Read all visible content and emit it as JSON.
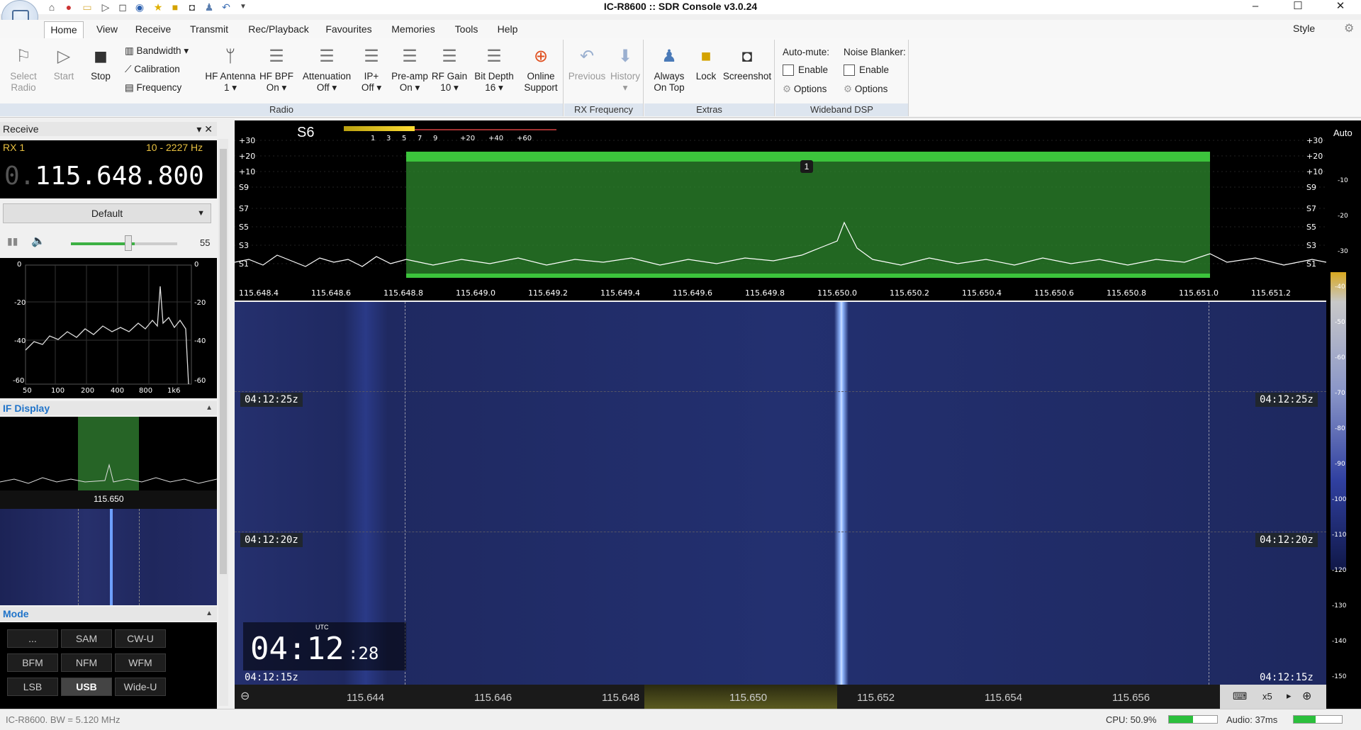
{
  "title": "IC-R8600 :: SDR Console v3.0.24",
  "tabs": [
    "Home",
    "View",
    "Receive",
    "Transmit",
    "Rec/Playback",
    "Favourites",
    "Memories",
    "Tools",
    "Help"
  ],
  "style_label": "Style",
  "ribbon": {
    "select_radio": "Select\nRadio",
    "start": "Start",
    "stop": "Stop",
    "bandwidth": "Bandwidth",
    "calibration": "Calibration",
    "frequency": "Frequency",
    "hf_antenna": "HF Antenna",
    "hf_antenna_val": "1",
    "hf_bpf": "HF BPF",
    "hf_bpf_val": "On",
    "attenuation": "Attenuation",
    "attenuation_val": "Off",
    "ip_plus": "IP+",
    "ip_plus_val": "Off",
    "preamp": "Pre-amp",
    "preamp_val": "On",
    "rf_gain": "RF Gain",
    "rf_gain_val": "10",
    "bit_depth": "Bit Depth",
    "bit_depth_val": "16",
    "online_support": "Online\nSupport",
    "previous": "Previous",
    "history": "History",
    "always_on_top": "Always\nOn Top",
    "lock": "Lock",
    "screenshot": "Screenshot",
    "auto_mute": "Auto-mute:",
    "noise_blanker": "Noise Blanker:",
    "enable": "Enable",
    "options": "Options",
    "groups": {
      "radio": "Radio",
      "rx_frequency": "RX Frequency",
      "extras": "Extras",
      "wideband_dsp": "Wideband DSP"
    }
  },
  "left": {
    "receive_title": "Receive",
    "rx": "RX 1",
    "bw": "10 - 2227 Hz",
    "freq_prefix": "0.",
    "freq": "115.648.800",
    "preset": "Default",
    "volume": "55",
    "audio_scale_y": [
      "0",
      "-20",
      "-40",
      "-60"
    ],
    "audio_scale_x": [
      "50",
      "100",
      "200",
      "400",
      "800",
      "1k6"
    ],
    "if_display_title": "IF Display",
    "if_freq": "115.650",
    "mode_title": "Mode",
    "modes": [
      "...",
      "SAM",
      "CW-U",
      "BFM",
      "NFM",
      "WFM",
      "LSB",
      "USB",
      "Wide-U"
    ]
  },
  "spectrum": {
    "s_meter": "S6",
    "auto": "Auto",
    "meter_scale": [
      "1",
      "3",
      "5",
      "7",
      "9",
      "+20",
      "+40",
      "+60"
    ],
    "db_left": [
      "+30",
      "+20",
      "+10",
      "S9",
      "S7",
      "S5",
      "S3",
      "S1"
    ],
    "db_right": [
      "+30",
      "+20",
      "+10",
      "S9",
      "S7",
      "S5",
      "S3",
      "S1"
    ],
    "marker": "1",
    "freq_ticks": [
      "115.648.4",
      "115.648.6",
      "115.648.8",
      "115.649.0",
      "115.649.2",
      "115.649.4",
      "115.649.6",
      "115.649.8",
      "115.650.0",
      "115.650.2",
      "115.650.4",
      "115.650.6",
      "115.650.8",
      "115.651.0",
      "115.651.2"
    ],
    "right_scale": [
      "-10",
      "-20",
      "-30",
      "-40",
      "-50",
      "-60",
      "-70",
      "-80",
      "-90",
      "-100",
      "-110",
      "-120",
      "-130",
      "-140",
      "-150"
    ]
  },
  "waterfall": {
    "times": [
      "04:12:25z",
      "04:12:20z",
      "04:12:15z"
    ],
    "utc_label": "UTC",
    "clock_hm": "04:12",
    "clock_s": ":28",
    "bottom_ticks": [
      "115.644",
      "115.646",
      "115.648",
      "115.650",
      "115.652",
      "115.654",
      "115.656"
    ],
    "zoom": "x5"
  },
  "status": {
    "left": "IC-R8600. BW = 5.120 MHz",
    "cpu": "CPU: 50.9%",
    "audio": "Audio: 37ms"
  }
}
